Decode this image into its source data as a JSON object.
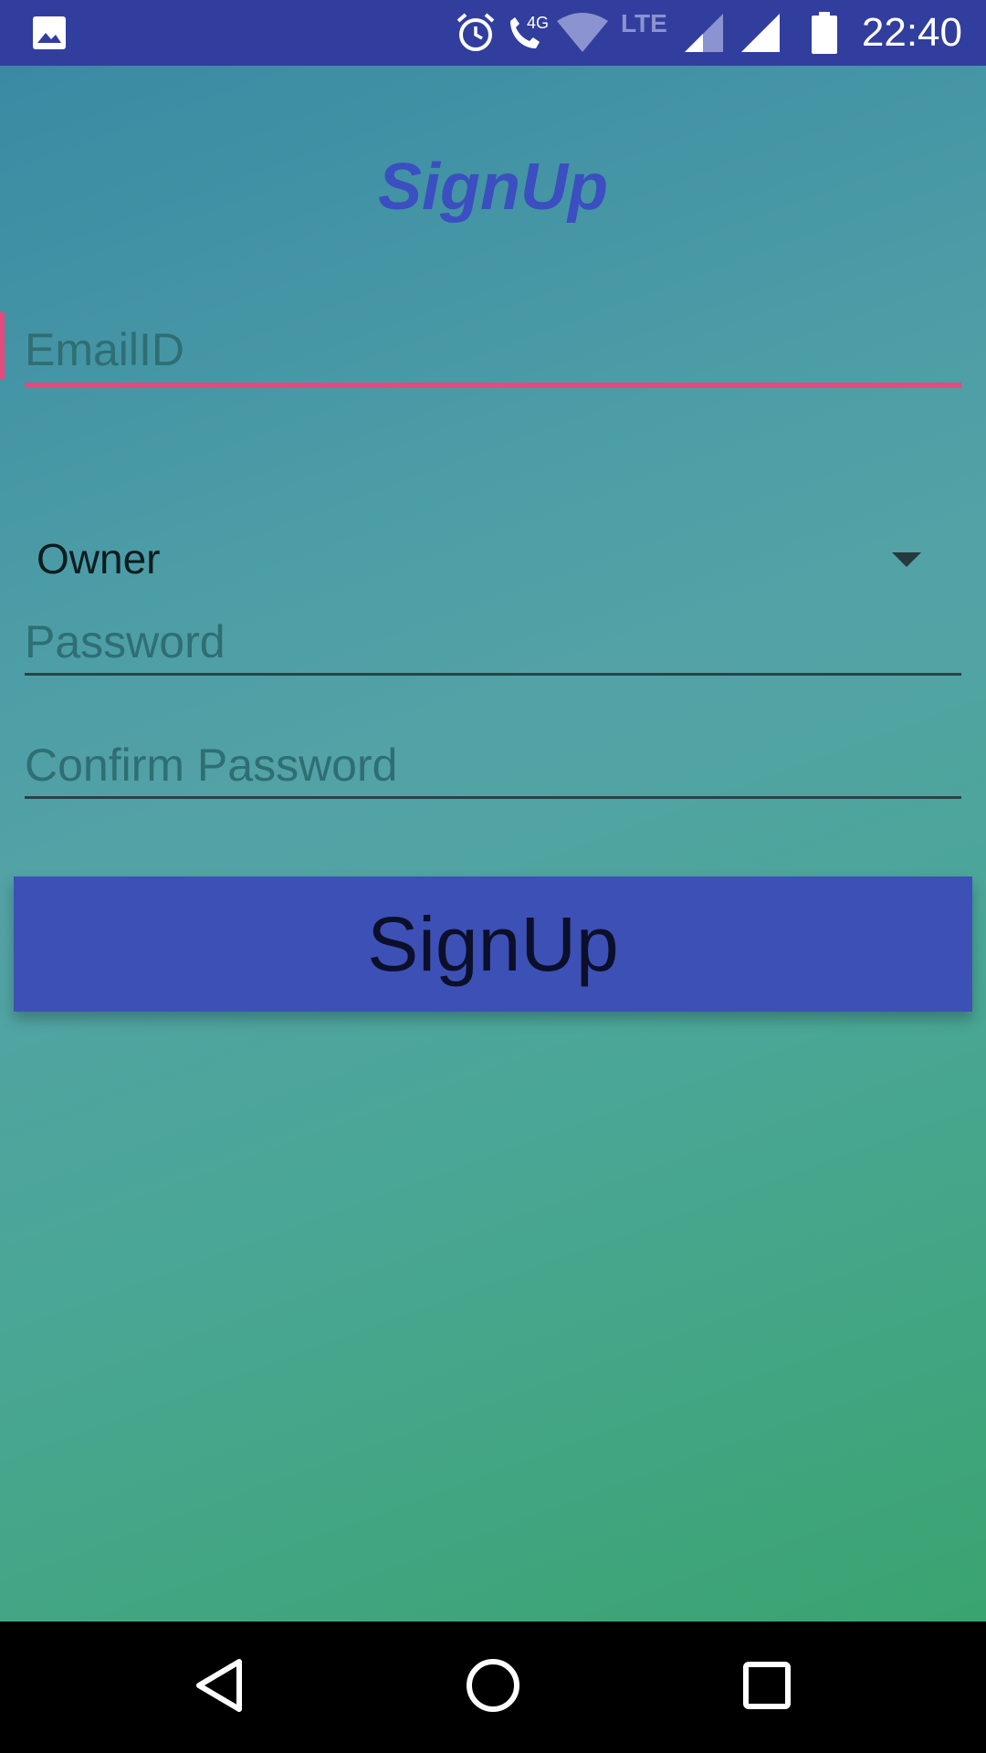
{
  "status_bar": {
    "time": "22:40",
    "icons": [
      "image-notification-icon",
      "alarm-icon",
      "call-4g-icon",
      "wifi-icon",
      "lte-icon",
      "signal-icon",
      "signal-icon",
      "battery-icon"
    ],
    "network_labels": {
      "call": "4G",
      "data": "LTE"
    }
  },
  "screen": {
    "title": "SignUp"
  },
  "form": {
    "email_placeholder": "EmailID",
    "role_value": "Owner",
    "password_placeholder": "Password",
    "confirm_placeholder": "Confirm Password",
    "submit_label": "SignUp"
  },
  "colors": {
    "status_bar": "#313e9e",
    "title": "#3b4fc0",
    "accent": "#e24a80",
    "button": "#3d50b5",
    "gradient_start": "#3a8aa4",
    "gradient_end": "#3aa470"
  },
  "nav_bar": {
    "buttons": [
      "back-icon",
      "home-icon",
      "recents-icon"
    ]
  }
}
